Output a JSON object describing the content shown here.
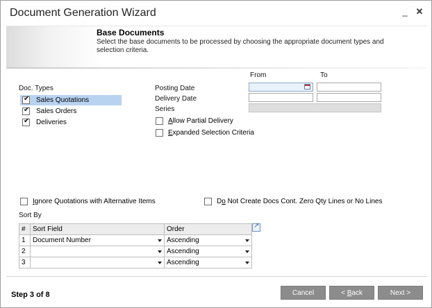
{
  "window": {
    "title": "Document Generation Wizard",
    "minimize_glyph": "_",
    "close_glyph": "✕"
  },
  "header": {
    "title": "Base Documents",
    "description": "Select the base documents to be processed by choosing the appropriate document types and selection criteria."
  },
  "doc_types": {
    "label": "Doc. Types",
    "items": [
      {
        "label": "Sales Quotations",
        "checked": true,
        "selected": true
      },
      {
        "label": "Sales Orders",
        "checked": true,
        "selected": false
      },
      {
        "label": "Deliveries",
        "checked": true,
        "selected": false
      }
    ]
  },
  "criteria": {
    "from_label": "From",
    "to_label": "To",
    "posting_date_label": "Posting Date",
    "delivery_date_label": "Delivery Date",
    "series_label": "Series",
    "posting_date_from": "",
    "posting_date_to": "",
    "delivery_date_from": "",
    "delivery_date_to": "",
    "series_value": "",
    "allow_partial_prefix": "A",
    "allow_partial_rest": "llow Partial Delivery",
    "allow_partial_checked": false,
    "expanded_prefix": "E",
    "expanded_rest": "xpanded Selection Criteria",
    "expanded_checked": false
  },
  "options": {
    "ignore_prefix": "I",
    "ignore_rest": "gnore Quotations with Alternative Items",
    "ignore_checked": false,
    "zero_qty_pre": "D",
    "zero_qty_u": "o",
    "zero_qty_rest": " Not Create Docs Cont. Zero Qty Lines or No Lines",
    "zero_qty_checked": false
  },
  "sort": {
    "label": "Sort By",
    "columns": [
      "#",
      "Sort Field",
      "Order"
    ],
    "rows": [
      {
        "num": "1",
        "field": "Document Number",
        "order": "Ascending"
      },
      {
        "num": "2",
        "field": "",
        "order": "Ascending"
      },
      {
        "num": "3",
        "field": "",
        "order": "Ascending"
      }
    ]
  },
  "footer": {
    "step": "Step 3 of 8",
    "cancel": "Cancel",
    "back_prefix": "< ",
    "back_u": "B",
    "back_rest": "ack",
    "next": "Next >"
  },
  "colors": {
    "selection": "#b8d3f0",
    "button": "#8c8c8c",
    "active_field": "#e9f1fb"
  }
}
